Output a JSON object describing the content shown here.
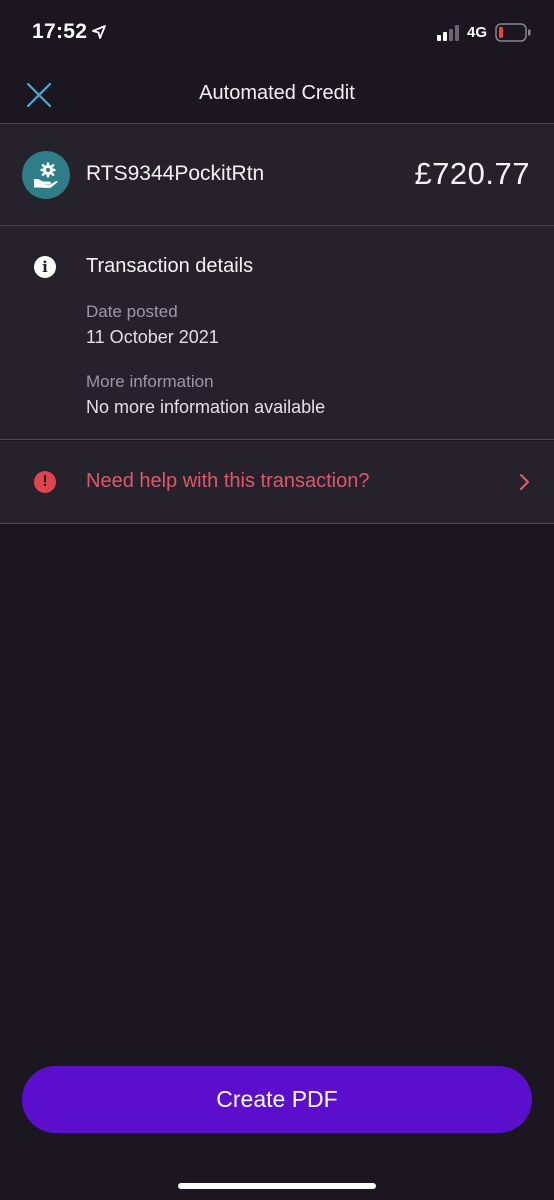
{
  "status_bar": {
    "time": "17:52",
    "network": "4G",
    "icons": [
      "location-arrow-icon",
      "signal-icon",
      "battery-icon"
    ]
  },
  "header": {
    "title": "Automated Credit",
    "close_icon": "close-icon"
  },
  "merchant": {
    "name": "RTS9344PockitRtn",
    "amount": "£720.77",
    "icon": "hand-gear-icon"
  },
  "details": {
    "title": "Transaction details",
    "icon": "info-icon",
    "fields": [
      {
        "label": "Date posted",
        "value": "11 October 2021"
      },
      {
        "label": "More information",
        "value": "No more information available"
      }
    ]
  },
  "help": {
    "text": "Need help with this transaction?",
    "icon": "alert-icon"
  },
  "actions": {
    "create_pdf_label": "Create PDF"
  },
  "colors": {
    "background": "#1b1721",
    "panel": "#25222b",
    "accent_purple": "#5b0fcc",
    "help_red": "#e0566a",
    "close_blue": "#4aa8d8",
    "avatar_teal": "#2f7d86"
  }
}
